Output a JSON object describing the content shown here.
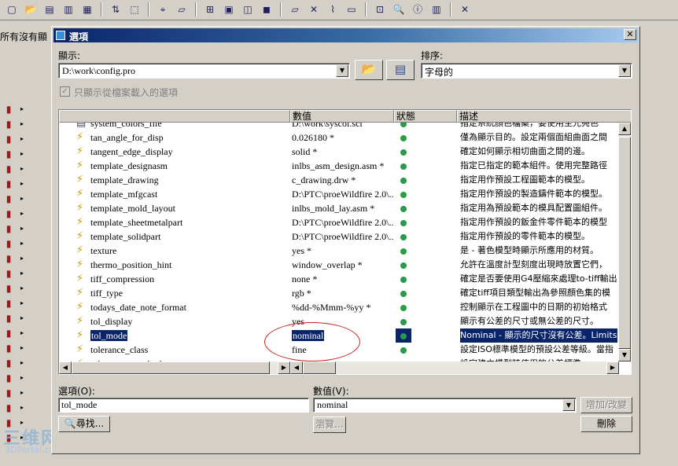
{
  "app": {
    "strip_text": "所有沒有顯",
    "watermark": {
      "big": "三维网",
      "small": "3DPortal.cn"
    },
    "toolbar_icons": [
      "new-icon",
      "open-icon",
      "save-icon",
      "save-as-icon",
      "print-icon",
      "regen-icon",
      "select-box-icon",
      "datum-icon",
      "plane-icon",
      "axis-icon",
      "view-icon",
      "cube-icon",
      "shade-icon",
      "edit-icon",
      "cross-icon",
      "dim-icon",
      "note-icon",
      "measure-icon",
      "search-icon",
      "info-icon",
      "color-icon",
      "close-icon"
    ]
  },
  "dialog": {
    "title": "選項",
    "show_label": "顯示:",
    "show_path": "D:\\work\\config.pro",
    "sort_label": "排序:",
    "sort_value": "字母的",
    "only_loaded_label": "只顯示從檔案載入的選項",
    "table": {
      "headers": [
        "",
        "數值",
        "狀態",
        "描述"
      ],
      "rows": [
        {
          "name": "system_colors_file",
          "value": "D:\\work\\syscol.scl",
          "desc": "指定系統顏色檔案，要使用至光亮色"
        },
        {
          "name": "tan_angle_for_disp",
          "value": "0.026180 *",
          "desc": "僅為顯示目的。設定兩個面組曲面之間"
        },
        {
          "name": "tangent_edge_display",
          "value": "solid *",
          "desc": "確定如何顯示相切曲面之間的邊。"
        },
        {
          "name": "template_designasm",
          "value": "inlbs_asm_design.asm *",
          "desc": "指定已指定的範本組件。使用完整路徑"
        },
        {
          "name": "template_drawing",
          "value": "c_drawing.drw *",
          "desc": "指定用作預設工程圖範本的模型。"
        },
        {
          "name": "template_mfgcast",
          "value": "D:\\PTC\\proeWildfire 2.0\\...",
          "desc": "指定用作預設的製造鑄件範本的模型。"
        },
        {
          "name": "template_mold_layout",
          "value": "inlbs_mold_lay.asm *",
          "desc": "指定用為預設範本的模具配置圖組件。"
        },
        {
          "name": "template_sheetmetalpart",
          "value": "D:\\PTC\\proeWildfire 2.0\\...",
          "desc": "指定用作預設的鈑金件零件範本的模型"
        },
        {
          "name": "template_solidpart",
          "value": "D:\\PTC\\proeWildfire 2.0\\...",
          "desc": "指定用作預設的零件範本的模型。"
        },
        {
          "name": "texture",
          "value": "yes *",
          "desc": "是 - 著色模型時顯示所應用的材質。"
        },
        {
          "name": "thermo_position_hint",
          "value": "window_overlap *",
          "desc": "允許在溫度計型刻度出現時放置它們，"
        },
        {
          "name": "tiff_compression",
          "value": "none *",
          "desc": "確定是否要使用G4壓縮來處理to-tiff輸出"
        },
        {
          "name": "tiff_type",
          "value": "rgb *",
          "desc": "確定tiff項目類型輸出為參照顏色集的模"
        },
        {
          "name": "todays_date_note_format",
          "value": "%dd-%Mmm-%yy *",
          "desc": "控制顯示在工程圖中的日期的初始格式"
        },
        {
          "name": "tol_display",
          "value": "yes",
          "desc": "顯示有公差的尺寸或無公差的尺寸。"
        },
        {
          "name": "tol_mode",
          "value": "nominal",
          "desc": "Nominal - 顯示的尺寸沒有公差。Limits"
        },
        {
          "name": "tolerance_class",
          "value": "fine",
          "desc": "設定ISO標準模型的預設公差等級。當指"
        },
        {
          "name": "tolerance_standard",
          "value": "ansi",
          "desc": "設定建立模型時使用的公差標準。"
        }
      ],
      "selected_index": 15
    },
    "option_label": "選項(O):",
    "option_value": "tol_mode",
    "value_label": "數值(V):",
    "value_value": "nominal",
    "find_label": "尋找...",
    "browse_label": "瀏覽...",
    "add_change_label": "增加/改變",
    "delete_label": "刪除"
  }
}
